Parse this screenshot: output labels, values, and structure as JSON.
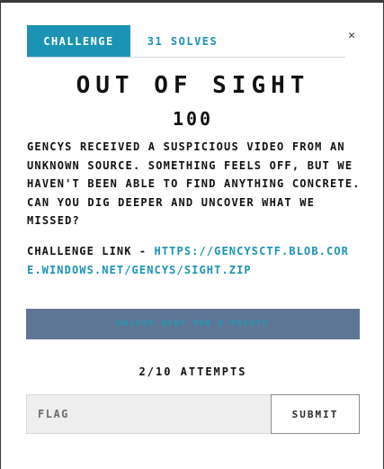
{
  "tabs": {
    "challenge_label": "CHALLENGE",
    "solves_label": "31 SOLVES"
  },
  "close_glyph": "✕",
  "challenge": {
    "title": "OUT OF SIGHT",
    "points": "100",
    "description": "GENCYS RECEIVED A SUSPICIOUS VIDEO FROM AN UNKNOWN SOURCE. SOMETHING FEELS OFF, BUT WE HAVEN'T BEEN ABLE TO FIND ANYTHING CONCRETE. CAN YOU DIG DEEPER AND UNCOVER WHAT WE MISSED?",
    "link_prefix": "CHALLENGE LINK - ",
    "link_text": "HTTPS://GENCYSCTF.BLOB.CORE.WINDOWS.NET/GENCYS/SIGHT.ZIP"
  },
  "hint": {
    "label": "UNLOCK HINT FOR 0 POINTS"
  },
  "attempts": {
    "text": "2/10 ATTEMPTS"
  },
  "flag_form": {
    "placeholder": "FLAG",
    "value": "",
    "submit_label": "SUBMIT"
  },
  "colors": {
    "accent": "#1b93b4",
    "hint_bar": "#5f7696"
  }
}
